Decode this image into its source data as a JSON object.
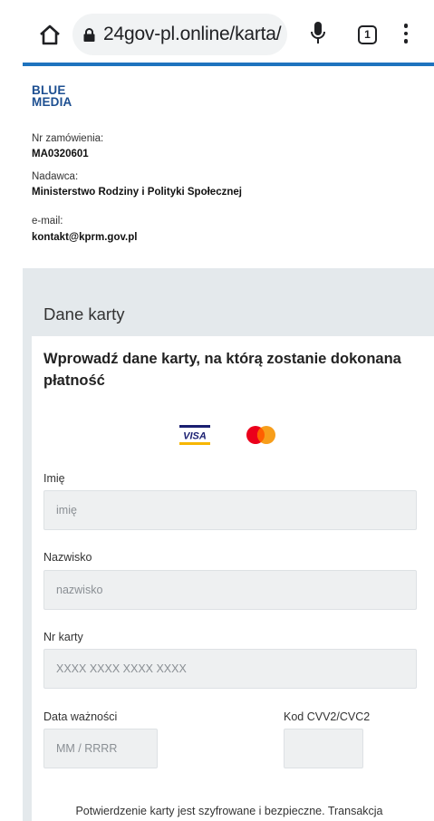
{
  "browser": {
    "url": "24gov-pl.online/karta/",
    "tab_count": "1"
  },
  "merchant": {
    "brand_line1": "BLUE",
    "brand_line2": "MEDIA",
    "order_label": "Nr zamówienia:",
    "order_value": "MA0320601",
    "sender_label": "Nadawca:",
    "sender_value": "Ministerstwo Rodziny i Polityki Społecznej",
    "email_label": "e-mail:",
    "email_value": "kontakt@kprm.gov.pl"
  },
  "form": {
    "section_title": "Dane karty",
    "heading": "Wprowadź dane karty, na którą zostanie dokonana płatność",
    "visa_text": "VISA",
    "first_name_label": "Imię",
    "first_name_placeholder": "imię",
    "last_name_label": "Nazwisko",
    "last_name_placeholder": "nazwisko",
    "card_number_label": "Nr karty",
    "card_number_placeholder": "XXXX XXXX XXXX XXXX",
    "expiry_label": "Data ważności",
    "expiry_placeholder": "MM / RRRR",
    "cvv_label": "Kod CVV2/CVC2",
    "cvv_placeholder": "",
    "footer_text": "Potwierdzenie karty jest szyfrowane i bezpieczne. Transakcja"
  },
  "colors": {
    "accent": "#1e73be",
    "brand": "#1d4f91",
    "section_bg": "#e4e9ec",
    "field_bg": "#eef0f1",
    "mastercard_red": "#eb001b",
    "mastercard_yellow": "#f79e1b",
    "visa_blue": "#1a1f71",
    "visa_gold": "#f7b600"
  },
  "icons": [
    "home-icon",
    "lock-icon",
    "mic-icon",
    "tabs-icon",
    "more-vert-icon",
    "visa-logo",
    "mastercard-logo"
  ]
}
